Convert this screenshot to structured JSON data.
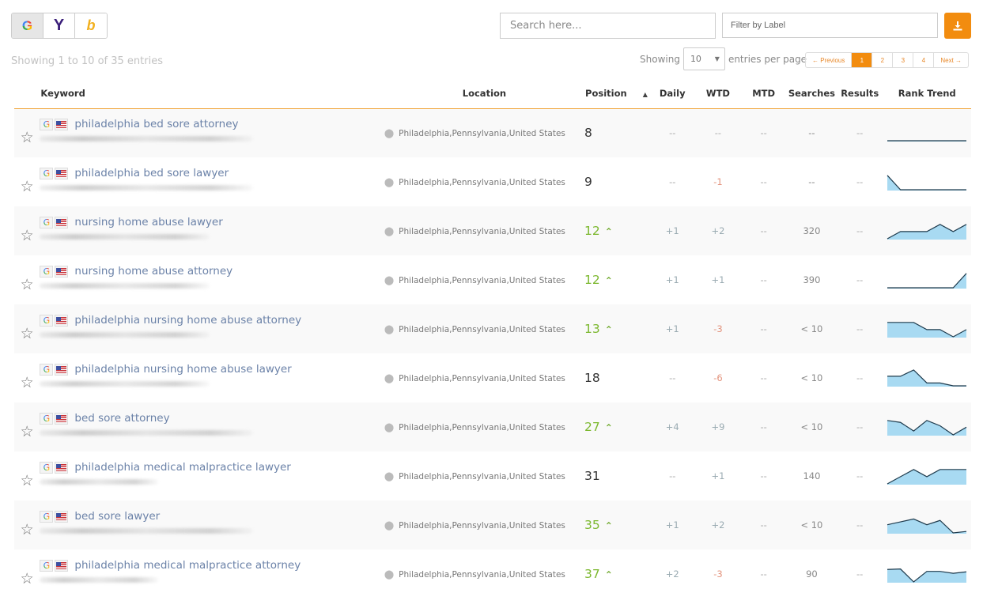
{
  "engines": [
    {
      "id": "google",
      "glyph": "G",
      "active": true
    },
    {
      "id": "yahoo",
      "glyph": "Y",
      "active": false
    },
    {
      "id": "bing",
      "glyph": "b",
      "active": false
    }
  ],
  "summary": "Showing 1 to 10 of 35 entries",
  "search": {
    "placeholder": "Search here..."
  },
  "filter": {
    "placeholder": "Filter by Label"
  },
  "download": {
    "icon": "download-icon"
  },
  "per_page": {
    "prefix": "Showing",
    "value": "10",
    "suffix": "entries per page"
  },
  "pagination": {
    "previous": "← Previous",
    "pages": [
      "1",
      "2",
      "3",
      "4"
    ],
    "active": "1",
    "next": "Next →"
  },
  "columns": {
    "keyword": "Keyword",
    "location": "Location",
    "position": "Position",
    "daily": "Daily",
    "wtd": "WTD",
    "mtd": "MTD",
    "searches": "Searches",
    "results": "Results",
    "rank_trend": "Rank Trend"
  },
  "sort": {
    "column": "position",
    "direction": "asc"
  },
  "colors": {
    "accent": "#f28c0f",
    "up": "#7cb82f",
    "down": "#e3947e",
    "keyword_link": "#6b82a8",
    "spark_fill": "#a8daf2",
    "spark_line": "#1e3a4c"
  },
  "rows": [
    {
      "keyword": "philadelphia bed sore attorney",
      "location": "Philadelphia,Pennsylvania,United States",
      "position": "8",
      "improved": false,
      "daily": "--",
      "wtd": "--",
      "mtd": "--",
      "searches": "--",
      "results": "--",
      "trend": [
        0,
        0,
        0,
        0,
        0,
        0,
        0
      ]
    },
    {
      "keyword": "philadelphia bed sore lawyer",
      "location": "Philadelphia,Pennsylvania,United States",
      "position": "9",
      "improved": false,
      "daily": "--",
      "wtd": "-1",
      "mtd": "--",
      "searches": "--",
      "results": "--",
      "trend": [
        3,
        0,
        0,
        0,
        0,
        0,
        0
      ]
    },
    {
      "keyword": "nursing home abuse lawyer",
      "location": "Philadelphia,Pennsylvania,United States",
      "position": "12",
      "improved": true,
      "daily": "+1",
      "wtd": "+2",
      "mtd": "--",
      "searches": "320",
      "results": "--",
      "trend": [
        0,
        1.5,
        1.5,
        1.5,
        3,
        1.5,
        3
      ]
    },
    {
      "keyword": "nursing home abuse attorney",
      "location": "Philadelphia,Pennsylvania,United States",
      "position": "12",
      "improved": true,
      "daily": "+1",
      "wtd": "+1",
      "mtd": "--",
      "searches": "390",
      "results": "--",
      "trend": [
        0,
        0,
        0,
        0,
        0,
        0,
        3
      ]
    },
    {
      "keyword": "philadelphia nursing home abuse attorney",
      "location": "Philadelphia,Pennsylvania,United States",
      "position": "13",
      "improved": true,
      "daily": "+1",
      "wtd": "-3",
      "mtd": "--",
      "searches": "< 10",
      "results": "--",
      "trend": [
        3,
        3,
        3,
        1.5,
        1.5,
        0,
        1.5
      ]
    },
    {
      "keyword": "philadelphia nursing home abuse lawyer",
      "location": "Philadelphia,Pennsylvania,United States",
      "position": "18",
      "improved": false,
      "daily": "--",
      "wtd": "-6",
      "mtd": "--",
      "searches": "< 10",
      "results": "--",
      "trend": [
        2,
        2,
        3.3,
        0.6,
        0.6,
        0,
        0
      ]
    },
    {
      "keyword": "bed sore attorney",
      "location": "Philadelphia,Pennsylvania,United States",
      "position": "27",
      "improved": true,
      "daily": "+4",
      "wtd": "+9",
      "mtd": "--",
      "searches": "< 10",
      "results": "--",
      "trend": [
        3,
        2.6,
        0.8,
        3,
        1.9,
        0,
        1.6
      ]
    },
    {
      "keyword": "philadelphia medical malpractice lawyer",
      "location": "Philadelphia,Pennsylvania,United States",
      "position": "31",
      "improved": false,
      "daily": "--",
      "wtd": "+1",
      "mtd": "--",
      "searches": "140",
      "results": "--",
      "trend": [
        0,
        1.5,
        3,
        1.5,
        3,
        3,
        3
      ]
    },
    {
      "keyword": "bed sore lawyer",
      "location": "Philadelphia,Pennsylvania,United States",
      "position": "35",
      "improved": true,
      "daily": "+1",
      "wtd": "+2",
      "mtd": "--",
      "searches": "< 10",
      "results": "--",
      "trend": [
        1.7,
        2.3,
        2.9,
        1.7,
        2.6,
        0,
        0.3
      ]
    },
    {
      "keyword": "philadelphia medical malpractice attorney",
      "location": "Philadelphia,Pennsylvania,United States",
      "position": "37",
      "improved": true,
      "daily": "+2",
      "wtd": "-3",
      "mtd": "--",
      "searches": "90",
      "results": "--",
      "trend": [
        2.6,
        2.7,
        0,
        2.2,
        2.2,
        1.8,
        2.1
      ]
    }
  ]
}
